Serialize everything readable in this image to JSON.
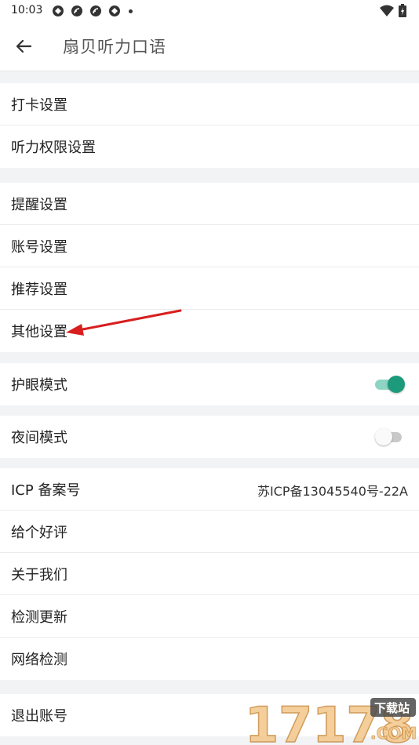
{
  "status": {
    "time": "10:03",
    "icons": [
      "sync-icon",
      "cast-icon",
      "cast-icon",
      "sync-icon"
    ],
    "right_icons": [
      "wifi-icon",
      "battery-icon"
    ]
  },
  "appbar": {
    "title": "扇贝听力口语"
  },
  "groups": [
    {
      "rows": [
        {
          "label": "打卡设置"
        },
        {
          "label": "听力权限设置"
        }
      ]
    },
    {
      "rows": [
        {
          "label": "提醒设置"
        },
        {
          "label": "账号设置"
        },
        {
          "label": "推荐设置"
        },
        {
          "label": "其他设置"
        }
      ]
    },
    {
      "rows": [
        {
          "label": "护眼模式",
          "toggle": "on"
        }
      ]
    },
    {
      "rows": [
        {
          "label": "夜间模式",
          "toggle": "off"
        }
      ]
    },
    {
      "rows": [
        {
          "label": "ICP 备案号",
          "value": "苏ICP备13045540号-22A"
        },
        {
          "label": "给个好评"
        },
        {
          "label": "关于我们"
        },
        {
          "label": "检测更新"
        },
        {
          "label": "网络检测"
        }
      ]
    },
    {
      "rows": [
        {
          "label": "退出账号"
        }
      ]
    }
  ],
  "colors": {
    "accent": "#1d9a7b",
    "annotation_arrow": "#d81e1e",
    "background": "#f2f3f5"
  },
  "watermark": {
    "main": "17178",
    "badge": "下载站",
    "suffix": ".COM"
  }
}
